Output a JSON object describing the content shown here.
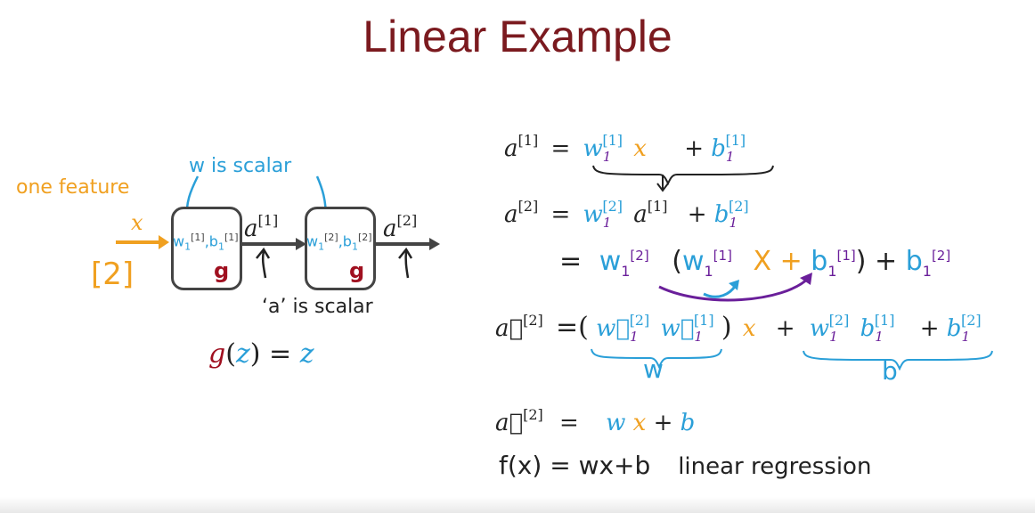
{
  "title": "Linear Example",
  "colors": {
    "title": "#7b1a1f",
    "orange": "#f0a020",
    "blue": "#2a9fd8",
    "purple": "#6a1f9a",
    "red": "#a01020"
  },
  "diagram": {
    "one_feature": "one feature",
    "w_is_scalar": "w is scalar",
    "x_input": "x",
    "example_input": "[2]",
    "node1": {
      "w": "w",
      "w_sub": "1",
      "w_sup": "[1]",
      "comma": ",",
      "b": "b",
      "b_sub": "1",
      "b_sup": "[1]",
      "g": "g"
    },
    "node2": {
      "w": "w",
      "w_sub": "1",
      "w_sup": "[2]",
      "comma": ",",
      "b": "b",
      "b_sub": "1",
      "b_sup": "[2]",
      "g": "g"
    },
    "a1": "a",
    "a1_sup": "[1]",
    "a2": "a",
    "a2_sup": "[2]",
    "a_is_scalar": "‘a’ is scalar",
    "g_def": {
      "g": "g",
      "lp": "(",
      "z": "z",
      "rp": ")",
      "eq": "=",
      "z2": "z"
    }
  },
  "equations": {
    "line1": {
      "a": "a",
      "a_sup": "[1]",
      "eq": "=",
      "w": "w",
      "w_sub": "1",
      "w_sup": "[1]",
      "x": "x",
      "plus": "+",
      "b": "b",
      "b_sub": "1",
      "b_sup": "[1]"
    },
    "line2": {
      "a": "a",
      "a_sup": "[2]",
      "eq": "=",
      "w": "w",
      "w_sub": "1",
      "w_sup": "[2]",
      "a2": "a",
      "a2_sup": "[1]",
      "plus": "+",
      "b": "b",
      "b_sub": "1",
      "b_sup": "[2]"
    },
    "line3": {
      "eq": "=",
      "w": "w",
      "w_sub": "1",
      "w_sup": "[2]",
      "lp": "(",
      "w2": "w",
      "w2_sub": "1",
      "w2_sup": "[1]",
      "x": "X",
      "plus": "+",
      "b": "b",
      "b_sub": "1",
      "b_sup": "[1]",
      "rp": ")",
      "plus2": "+",
      "b2": "b",
      "b2_sub": "1",
      "b2_sup": "[2]"
    },
    "line4": {
      "a": "a⃗",
      "a_sup": "[2]",
      "eq": "=(",
      "w": "w⃗",
      "w_sub": "1",
      "w_sup": "[2]",
      "w2": "w⃗",
      "w2_sub": "1",
      "w2_sup": "[1]",
      "rp": ")",
      "x": "x",
      "plus": "+",
      "w3": "w",
      "w3_sub": "1",
      "w3_sup": "[2]",
      "b": "b",
      "b_sub": "1",
      "b_sup": "[1]",
      "plus2": "+",
      "b2": "b",
      "b2_sub": "1",
      "b2_sup": "[2]",
      "brace1": "w",
      "brace2": "b"
    },
    "line5": {
      "a": "a⃗",
      "a_sup": "[2]",
      "eq": "=",
      "w": "w",
      "x": "x",
      "plus": "+",
      "b": "b"
    },
    "line6": {
      "f": "f(x)",
      "eq": "=",
      "rhs": "wx+b",
      "label": "linear regression"
    }
  }
}
